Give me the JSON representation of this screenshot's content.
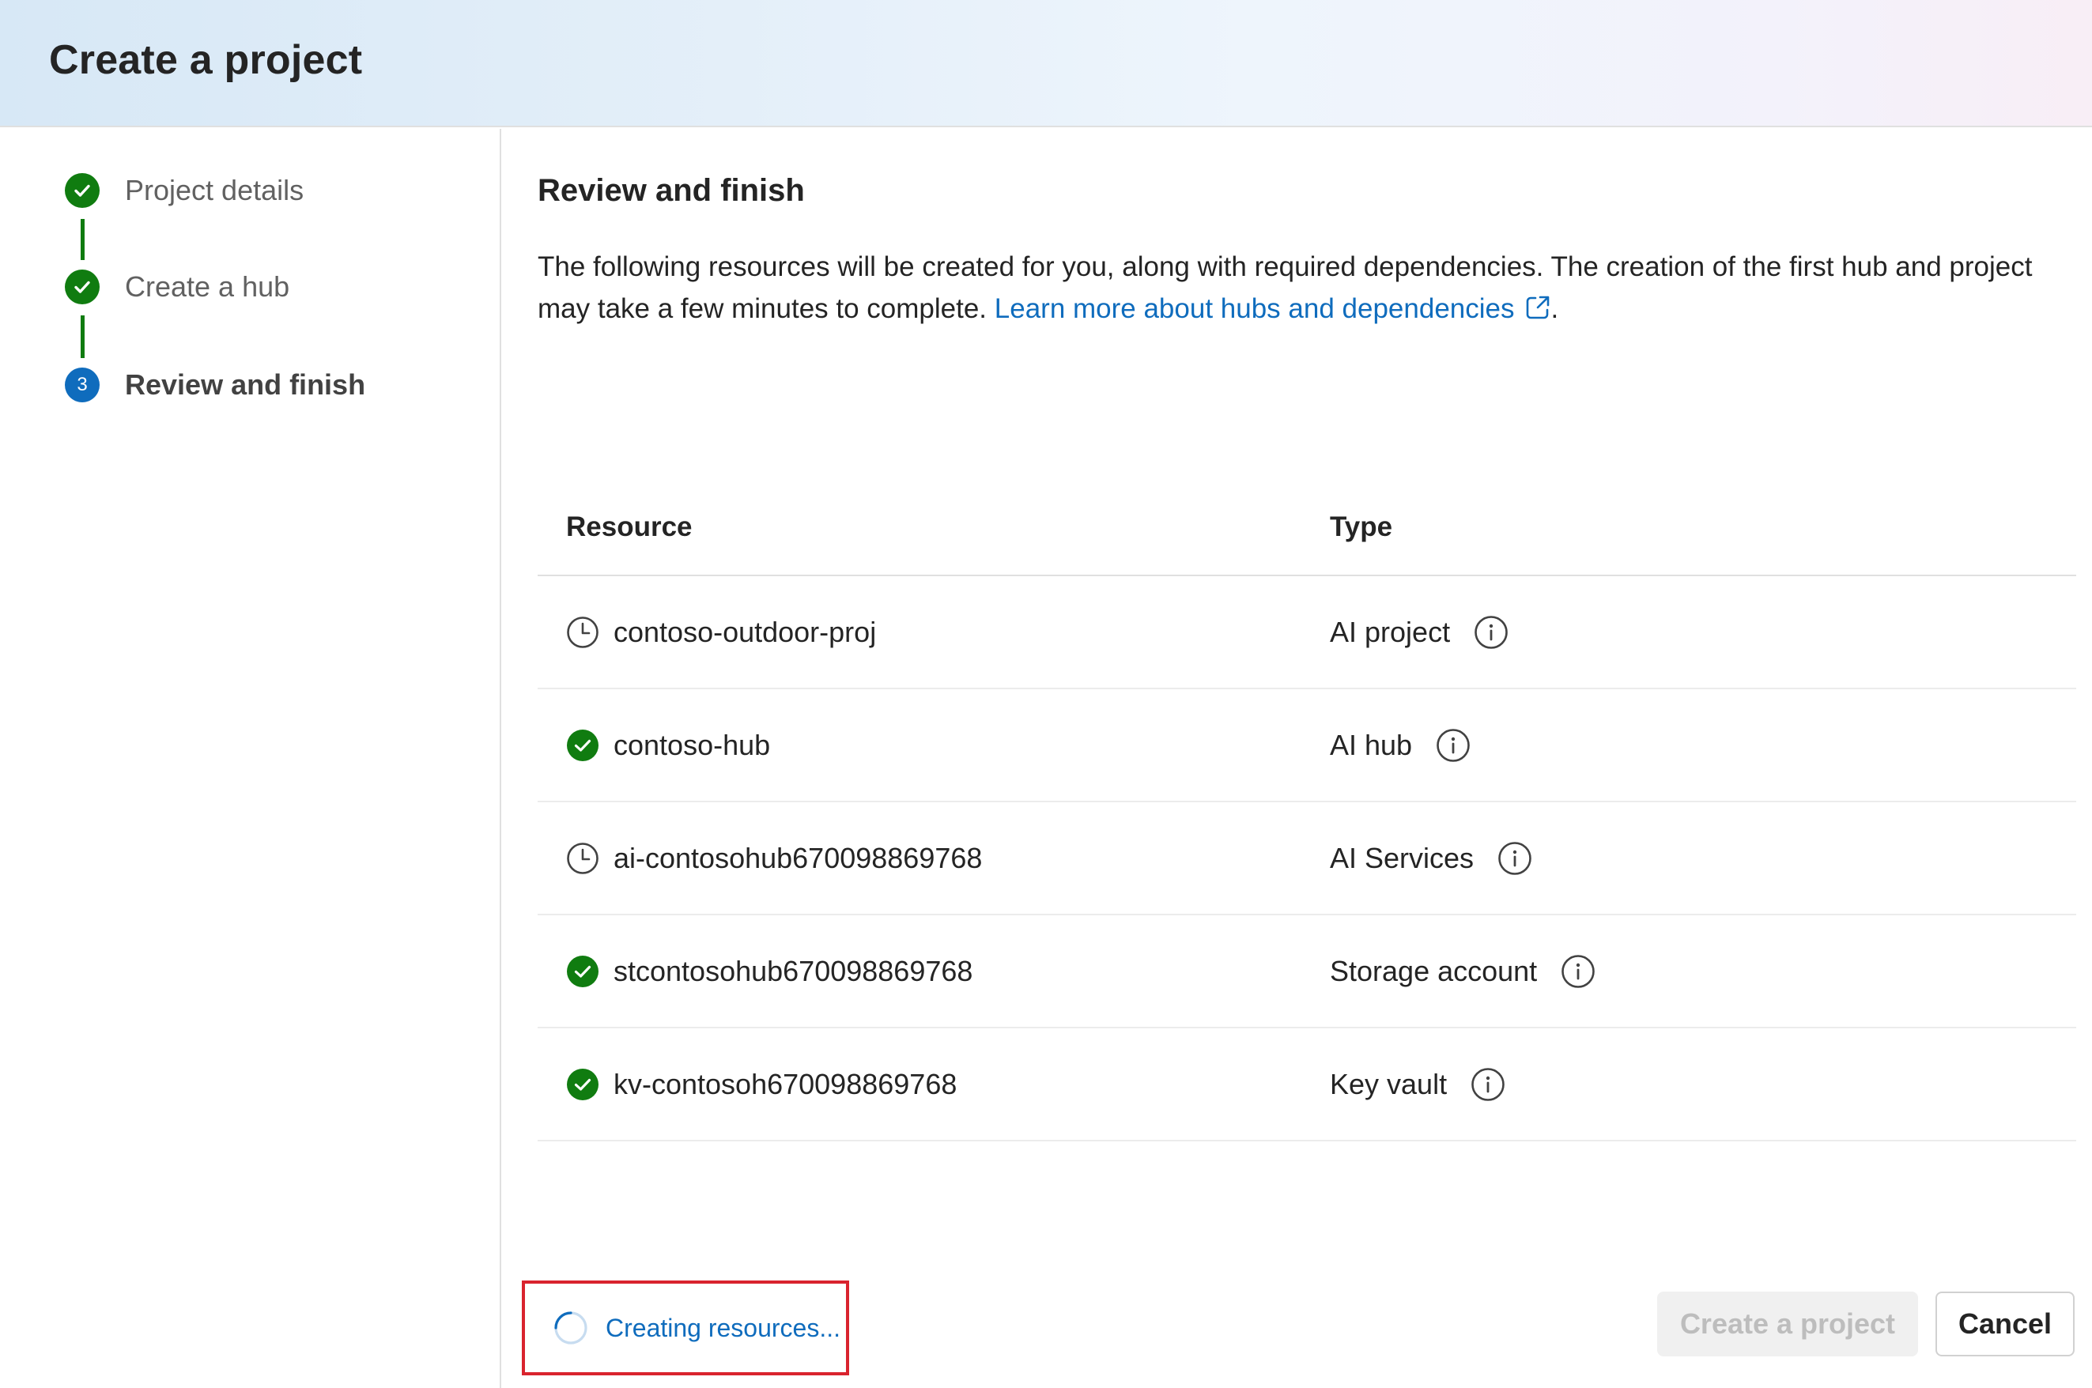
{
  "header": {
    "title": "Create a project"
  },
  "steps": [
    {
      "label": "Project details",
      "state": "done"
    },
    {
      "label": "Create a hub",
      "state": "done"
    },
    {
      "label": "Review and finish",
      "state": "current",
      "number": "3"
    }
  ],
  "main": {
    "title": "Review and finish",
    "description": "The following resources will be created for you, along with required dependencies. The creation of the first hub and project may take a few minutes to complete. ",
    "link_text": "Learn more about hubs and dependencies",
    "link_suffix": ".",
    "table": {
      "headers": {
        "resource": "Resource",
        "type": "Type"
      },
      "rows": [
        {
          "resource": "contoso-outdoor-proj",
          "type": "AI project",
          "status": "pending"
        },
        {
          "resource": "contoso-hub",
          "type": "AI hub",
          "status": "done"
        },
        {
          "resource": "ai-contosohub670098869768",
          "type": "AI Services",
          "status": "pending"
        },
        {
          "resource": "stcontosohub670098869768",
          "type": "Storage account",
          "status": "done"
        },
        {
          "resource": "kv-contosoh670098869768",
          "type": "Key vault",
          "status": "done"
        }
      ]
    }
  },
  "footer": {
    "status_text": "Creating resources...",
    "create_label": "Create a project",
    "cancel_label": "Cancel"
  },
  "colors": {
    "success": "#107c10",
    "brand": "#0f6cbd",
    "highlight": "#d9232e"
  },
  "icons": {
    "done": "checkmark-circle-icon",
    "pending": "clock-icon",
    "info": "info-icon",
    "external": "open-external-icon",
    "spinner": "spinner-icon"
  }
}
